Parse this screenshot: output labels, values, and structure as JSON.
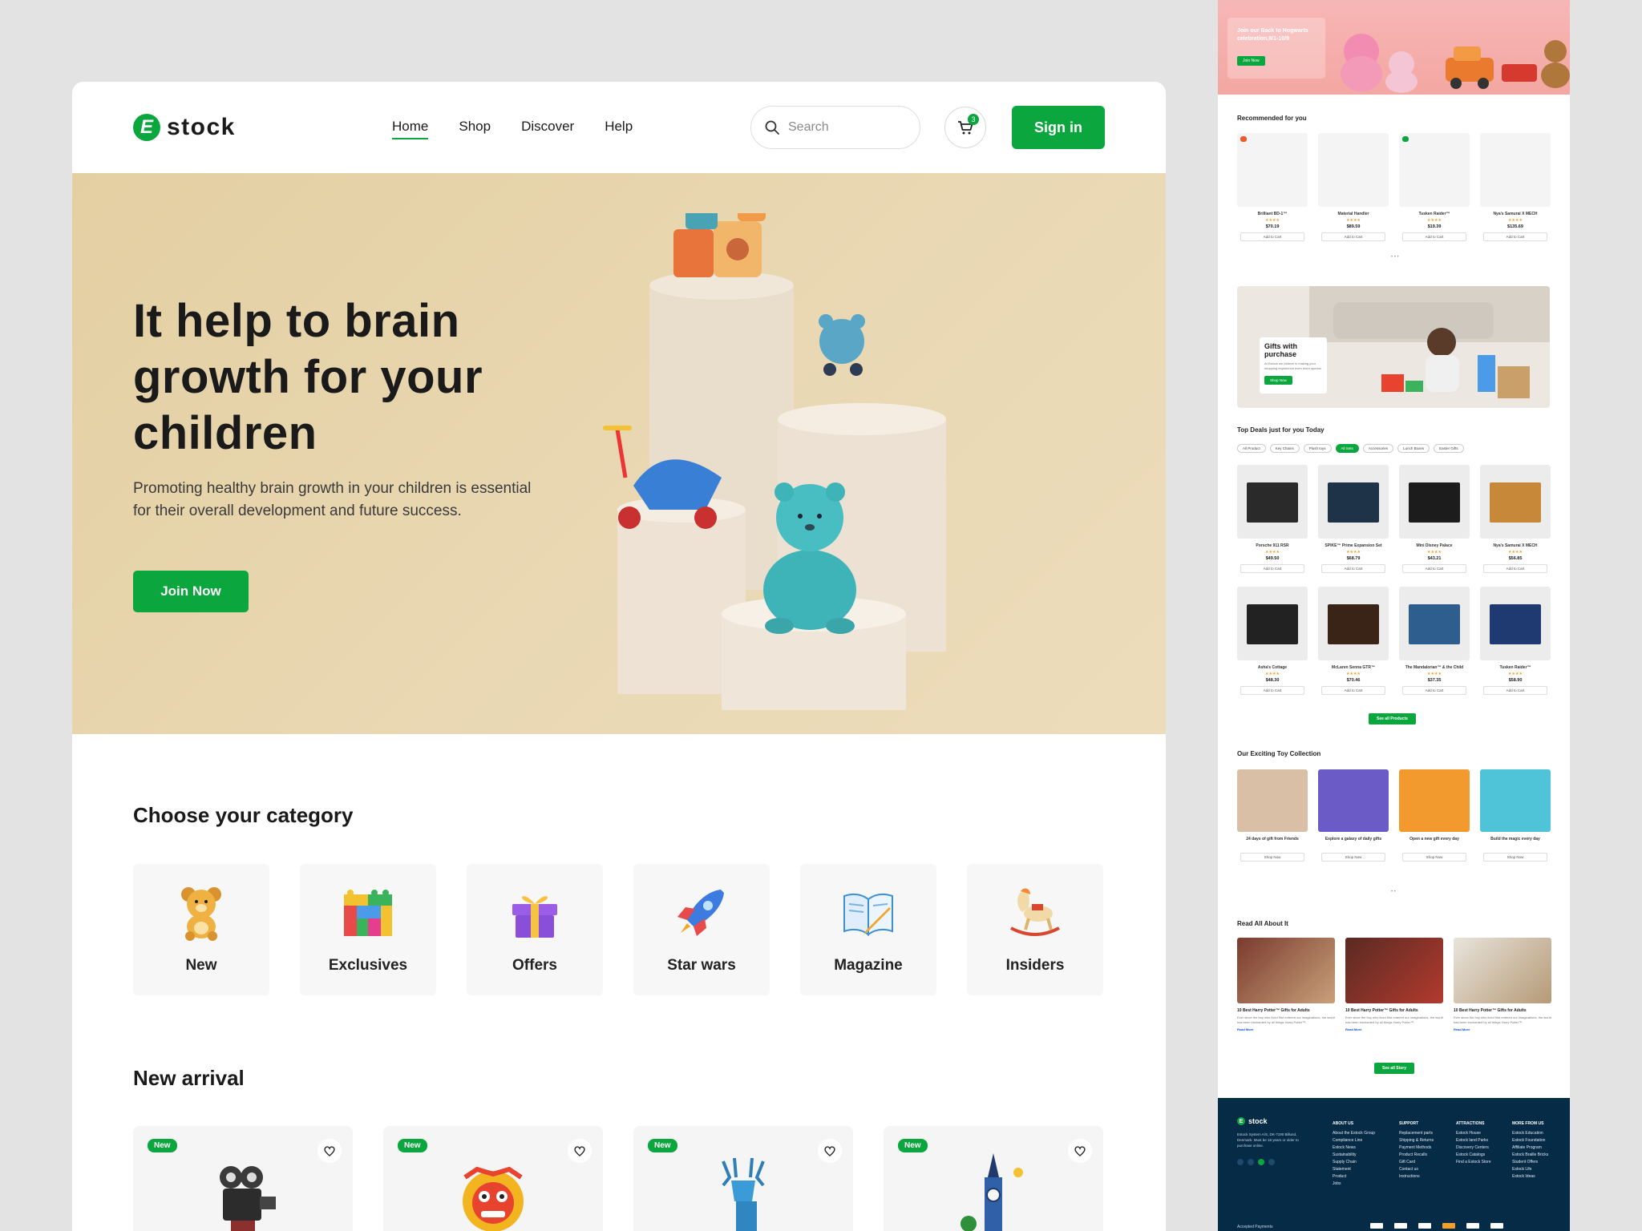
{
  "brand": {
    "logo_letter": "E",
    "name": "stock",
    "accent": "#0ba63d"
  },
  "nav": [
    {
      "label": "Home",
      "active": true
    },
    {
      "label": "Shop",
      "active": false
    },
    {
      "label": "Discover",
      "active": false
    },
    {
      "label": "Help",
      "active": false
    }
  ],
  "search": {
    "placeholder": "Search",
    "icon": "search-icon"
  },
  "cart": {
    "icon": "cart-icon",
    "count": "3"
  },
  "signin_label": "Sign in",
  "hero": {
    "title": "It help to brain growth  for your children",
    "subtitle": "Promoting healthy brain growth in your children is essential for their overall development and future success.",
    "cta": "Join Now"
  },
  "categories": {
    "title": "Choose your category",
    "items": [
      {
        "label": "New",
        "icon": "teddy-bear-icon"
      },
      {
        "label": "Exclusives",
        "icon": "building-blocks-icon"
      },
      {
        "label": "Offers",
        "icon": "gift-icon"
      },
      {
        "label": "Star wars",
        "icon": "rocket-icon"
      },
      {
        "label": "Magazine",
        "icon": "magazine-icon"
      },
      {
        "label": "Insiders",
        "icon": "rocking-horse-icon"
      }
    ]
  },
  "new_arrival": {
    "title": "New arrival",
    "badge": "New",
    "items": [
      {
        "icon": "camera-robot"
      },
      {
        "icon": "lion-dancer"
      },
      {
        "icon": "blue-deer"
      },
      {
        "icon": "big-ben-tower"
      }
    ]
  },
  "side": {
    "banner_text": "Join our Back to Hogwarts celebration,9/1-10/9",
    "banner_cta": "Join Now",
    "recommended": {
      "title": "Recommended for you",
      "items": [
        {
          "name": "Brilliant BD-1™",
          "price": "$70.19",
          "tag": "",
          "cta": "Add to Cart"
        },
        {
          "name": "Material Handler",
          "price": "$89.59",
          "tag": "",
          "cta": "Add to Cart"
        },
        {
          "name": "Tusken Raider™",
          "price": "$19.39",
          "tag": "",
          "cta": "Add to Cart"
        },
        {
          "name": "Nya's Samurai X MECH",
          "price": "$135.69",
          "tag": "",
          "cta": "Add to Cart"
        }
      ]
    },
    "promo": {
      "title": "Gifts with purchase",
      "text": "At Estock we believe in making your shopping experience even more special.",
      "cta": "Shop Now"
    },
    "deals": {
      "title": "Top Deals just for you Today",
      "chips": [
        {
          "label": "All Product",
          "on": false
        },
        {
          "label": "Key Chains",
          "on": false
        },
        {
          "label": "Plush toys",
          "on": false
        },
        {
          "label": "All Sets",
          "on": true
        },
        {
          "label": "Accessories",
          "on": false
        },
        {
          "label": "Lunch Boxes",
          "on": false
        },
        {
          "label": "Easter Gifts",
          "on": false
        }
      ],
      "items": [
        {
          "name": "Porsche 911 RSR",
          "price": "$49.50",
          "cta": "Add to Cart"
        },
        {
          "name": "SPIKE™ Prime Expansion Set",
          "price": "$68.79",
          "cta": "Add to Cart"
        },
        {
          "name": "Mini Disney Palace",
          "price": "$43.21",
          "cta": "Add to Cart"
        },
        {
          "name": "Nya's Samurai X MECH",
          "price": "$56.85",
          "cta": "Add to Cart"
        },
        {
          "name": "Asha's Cottage",
          "price": "$48.30",
          "cta": "Add to Cart"
        },
        {
          "name": "McLaren Senna GTR™",
          "price": "$70.46",
          "cta": "Add to Cart"
        },
        {
          "name": "The Mandalorian™ & the Child",
          "price": "$37.35",
          "cta": "Add to Cart"
        },
        {
          "name": "Tusken Raider™",
          "price": "$58.90",
          "cta": "Add to Cart"
        }
      ],
      "cta": "See all Products"
    },
    "collection": {
      "title": "Our Exciting Toy Collection",
      "items": [
        {
          "name": "24 days of gift from Friends",
          "cta": "Shop Now"
        },
        {
          "name": "Explore a galaxy of daily gifts",
          "cta": "Shop Now"
        },
        {
          "name": "Open a new gift every day",
          "cta": "Shop Now"
        },
        {
          "name": "Build the magic every day",
          "cta": "Shop Now"
        }
      ]
    },
    "blog": {
      "title": "Read All About It",
      "items": [
        {
          "title": "10 Best Harry Potter™ Gifts for Adults",
          "desc": "Ever since the boy who lived first entered our imaginations, the world has been enchanted by all things Harry Potter™.",
          "more": "Read More"
        },
        {
          "title": "10 Best Harry Potter™ Gifts for Adults",
          "desc": "Ever since the boy who lived first entered our imaginations, the world has been enchanted by all things Harry Potter™.",
          "more": "Read More"
        },
        {
          "title": "10 Best Harry Potter™ Gifts for Adults",
          "desc": "Ever since the boy who lived first entered our imaginations, the world has been enchanted by all things Harry Potter™.",
          "more": "Read More"
        }
      ],
      "cta": "See all Story"
    },
    "footer": {
      "brand": "stock",
      "about_text": "Estock System A/S, DK-7190 Billund, Denmark. Must be 18 years or older to purchase online.",
      "columns": [
        {
          "title": "ABOUT US",
          "links": [
            "About the Estock Group",
            "Compliance Line",
            "Estock News",
            "Sustainability",
            "Supply Chain",
            "Statement",
            "Product",
            "Jobs"
          ]
        },
        {
          "title": "SUPPORT",
          "links": [
            "Replacement parts",
            "Shipping & Returns",
            "Payment Methods",
            "Product Recalls",
            "Gift Card",
            "Contact us",
            "Instructions"
          ]
        },
        {
          "title": "ATTRACTIONS",
          "links": [
            "Estock House",
            "Estock land Parks",
            "Discovery Centers",
            "Estock Catalogs",
            "Find a Estock Store"
          ]
        },
        {
          "title": "MORE FROM US",
          "links": [
            "Estock Education",
            "Estock Foundation",
            "Affiliate Program",
            "Estock Braille Bricks",
            "Student Offers",
            "Estock Life",
            "Estock Ideas"
          ]
        }
      ],
      "payments_label": "Accepted Payments"
    }
  }
}
